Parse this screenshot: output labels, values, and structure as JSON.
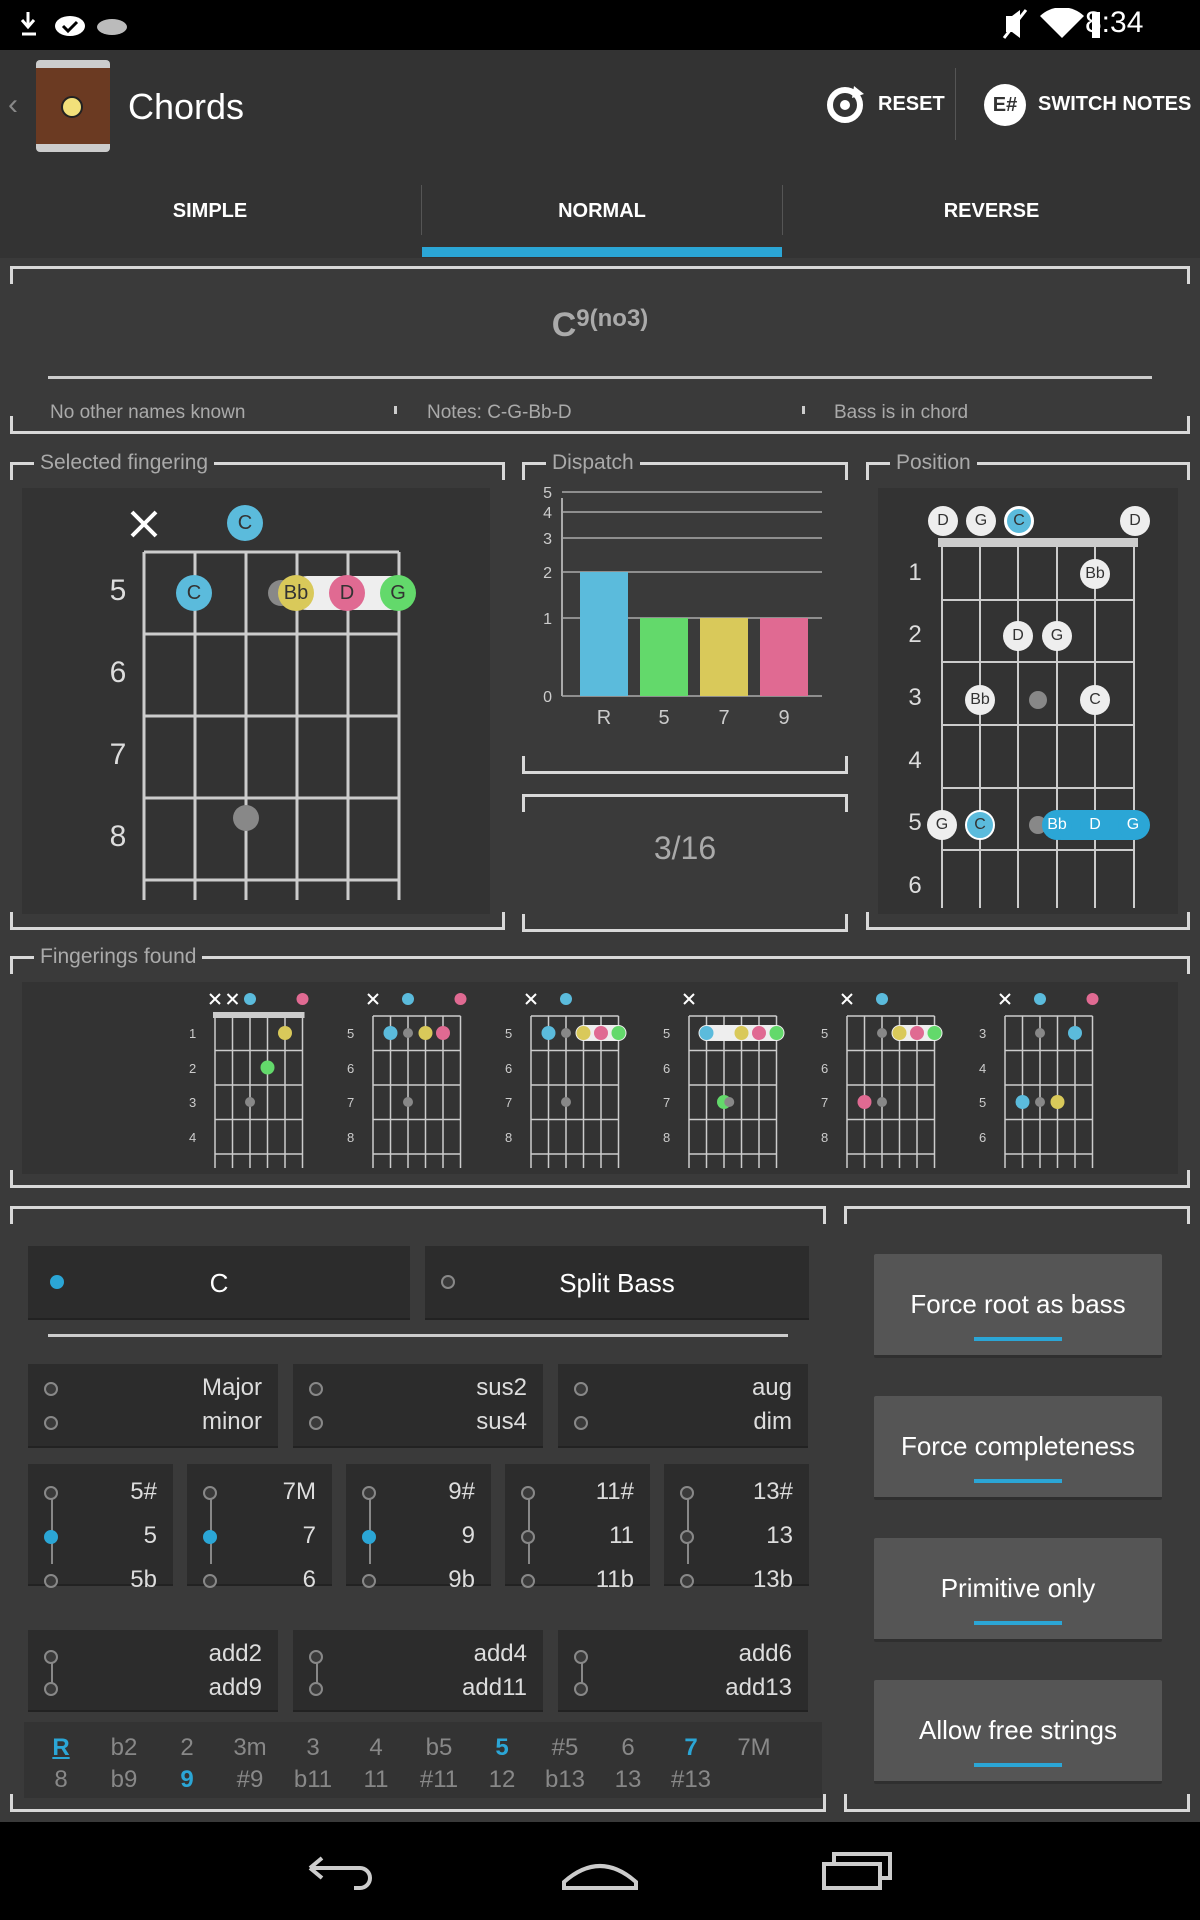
{
  "status": {
    "time": "8:34"
  },
  "app": {
    "title": "Chords",
    "reset_label": "RESET",
    "switch_label": "SWITCH NOTES",
    "switch_icon_text": "E#"
  },
  "tabs": [
    "SIMPLE",
    "NORMAL",
    "REVERSE"
  ],
  "active_tab": 1,
  "chord": {
    "root": "C",
    "sup": "9(no3)",
    "other_names": "No other names known",
    "notes": "Notes: C-G-Bb-D",
    "bass": "Bass is in chord"
  },
  "selected": {
    "legend": "Selected fingering",
    "frets": [
      "5",
      "6",
      "7",
      "8"
    ],
    "top_note": "C",
    "fret5_notes": [
      "C",
      "Bb",
      "D",
      "G"
    ]
  },
  "dispatch": {
    "legend": "Dispatch",
    "counter": "3/16"
  },
  "chart_data": {
    "type": "bar",
    "categories": [
      "R",
      "5",
      "7",
      "9"
    ],
    "values": [
      2,
      1,
      1,
      1
    ],
    "colors": [
      "#5bbbdc",
      "#63d96b",
      "#d9c95a",
      "#e06a92"
    ],
    "yticks": [
      "0",
      "1",
      "2",
      "3",
      "4",
      "5",
      "6"
    ],
    "ylim": [
      0,
      6
    ]
  },
  "position": {
    "legend": "Position",
    "frets": [
      "1",
      "2",
      "3",
      "4",
      "5",
      "6"
    ],
    "open_notes": [
      "D",
      "G",
      "C",
      "D"
    ],
    "f1": [
      "Bb"
    ],
    "f2": [
      "D",
      "G"
    ],
    "f3": [
      "Bb",
      "C"
    ],
    "f5": [
      "G",
      "C",
      "Bb",
      "D",
      "G"
    ]
  },
  "fingerings_found": {
    "legend": "Fingerings found",
    "diagrams": [
      {
        "frets": [
          "1",
          "2",
          "3",
          "4"
        ]
      },
      {
        "frets": [
          "5",
          "6",
          "7",
          "8"
        ]
      },
      {
        "frets": [
          "5",
          "6",
          "7",
          "8"
        ]
      },
      {
        "frets": [
          "5",
          "6",
          "7",
          "8"
        ]
      },
      {
        "frets": [
          "5",
          "6",
          "7",
          "8"
        ]
      },
      {
        "frets": [
          "3",
          "4",
          "5",
          "6"
        ]
      }
    ]
  },
  "root_select": {
    "root_label": "C",
    "split_label": "Split Bass"
  },
  "triad": [
    [
      "Major",
      "minor"
    ],
    [
      "sus2",
      "sus4"
    ],
    [
      "aug",
      "dim"
    ]
  ],
  "ext": [
    [
      "5#",
      "5",
      "5b"
    ],
    [
      "7M",
      "7",
      "6"
    ],
    [
      "9#",
      "9",
      "9b"
    ],
    [
      "11#",
      "11",
      "11b"
    ],
    [
      "13#",
      "13",
      "13b"
    ]
  ],
  "ext_sel": [
    1,
    1,
    1,
    -1,
    -1
  ],
  "adds": [
    [
      "add2",
      "add9"
    ],
    [
      "add4",
      "add11"
    ],
    [
      "add6",
      "add13"
    ]
  ],
  "intervals_row1": [
    "R",
    "b2",
    "2",
    "3m",
    "3",
    "4",
    "b5",
    "5",
    "#5",
    "6",
    "7",
    "7M"
  ],
  "intervals_row2": [
    "8",
    "b9",
    "9",
    "#9",
    "b11",
    "11",
    "#11",
    "12",
    "b13",
    "13",
    "#13"
  ],
  "intervals_on1": [
    0,
    7,
    10
  ],
  "intervals_on2": [
    2
  ],
  "right_buttons": [
    "Force root as bass",
    "Force completeness",
    "Primitive only",
    "Allow free strings"
  ]
}
